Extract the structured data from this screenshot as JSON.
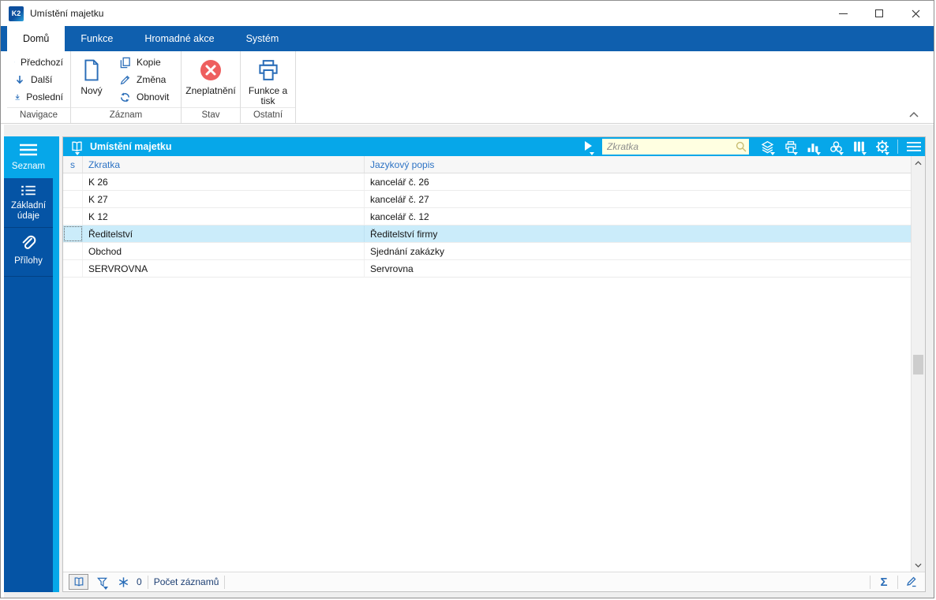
{
  "window": {
    "title": "Umístění majetku"
  },
  "ribbon": {
    "tabs": [
      "Domů",
      "Funkce",
      "Hromadné akce",
      "Systém"
    ],
    "groups": {
      "navigace": {
        "caption": "Navigace",
        "previous": "Předchozí",
        "next": "Další",
        "last": "Poslední"
      },
      "zaznam": {
        "caption": "Záznam",
        "new": "Nový",
        "copy": "Kopie",
        "change": "Změna",
        "refresh": "Obnovit"
      },
      "stav": {
        "caption": "Stav",
        "invalidate": "Zneplatnění"
      },
      "ostatni": {
        "caption": "Ostatní",
        "functions_and_print": "Funkce a tisk"
      }
    }
  },
  "sidebar": {
    "items": [
      {
        "label": "Seznam",
        "active": true,
        "icon": "list-icon"
      },
      {
        "label": "Základní údaje",
        "active": false,
        "icon": "detail-list-icon"
      },
      {
        "label": "Přílohy",
        "active": false,
        "icon": "paperclip-icon"
      }
    ]
  },
  "panel": {
    "title": "Umístění majetku",
    "search_placeholder": "Zkratka",
    "toolbar_icons": [
      "layers-icon",
      "print-icon",
      "chart-icon",
      "relations-icon",
      "columns-icon",
      "settings-gear-icon",
      "menu-icon"
    ],
    "table": {
      "columns": [
        "s",
        "Zkratka",
        "Jazykový popis"
      ],
      "rows": [
        {
          "zkratka": "K 26",
          "jazykovy_popis": "kancelář č. 26"
        },
        {
          "zkratka": "K 27",
          "jazykovy_popis": "kancelář č. 27"
        },
        {
          "zkratka": "K 12",
          "jazykovy_popis": "kancelář č. 12"
        },
        {
          "zkratka": "Ředitelství",
          "jazykovy_popis": "Ředitelství firmy",
          "selected": true
        },
        {
          "zkratka": "Obchod",
          "jazykovy_popis": "Sjednání zakázky"
        },
        {
          "zkratka": "SERVROVNA",
          "jazykovy_popis": "Servrovna"
        }
      ]
    },
    "status_bar": {
      "filter_badge_count": "0",
      "records_label": "Počet záznamů",
      "sum_symbol": "Σ"
    }
  },
  "colors": {
    "accent_cyan": "#06a7e9",
    "ribbon_blue": "#0f5fae",
    "sidebar_blue": "#0554a5",
    "icon_blue": "#2a6db8",
    "invalid_red": "#ee5f5f",
    "header_text_blue": "#2d73c4",
    "selected_row": "#cbecfa",
    "search_bg": "#ffffe1"
  }
}
